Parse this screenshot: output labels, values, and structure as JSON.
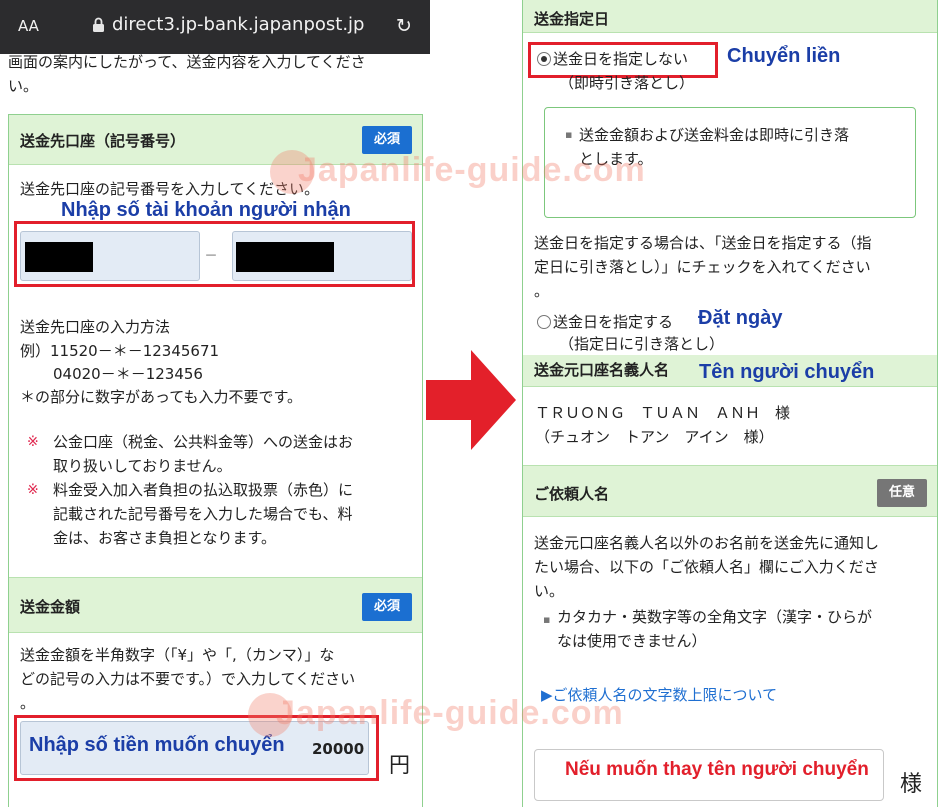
{
  "browser": {
    "text_size_label": "AA",
    "url": "direct3.jp-bank.japanpost.jp",
    "reload_glyph": "↻"
  },
  "left": {
    "intro_line1": "画面の案内にしたがって、送金内容を入力してくださ",
    "intro_line2": "い。",
    "account_section": {
      "title": "送金先口座（記号番号）",
      "required_badge": "必須",
      "instruction": "送金先口座の記号番号を入力してください。",
      "annotation": "Nhập số tài  khoản người nhận",
      "separator": "–",
      "method_title": "送金先口座の入力方法",
      "example_line1": "例）11520－＊－12345671",
      "example_line2": "04020－＊－123456",
      "example_line3": "＊の部分に数字があっても入力不要です。",
      "note1_line1": "公金口座（税金、公共料金等）への送金はお",
      "note1_line2": "取り扱いしておりません。",
      "note2_line1": "料金受入加入者負担の払込取扱票（赤色）に",
      "note2_line2": "記載された記号番号を入力した場合でも、料",
      "note2_line3": "金は、お客さま負担となります。",
      "note_mark": "※"
    },
    "amount_section": {
      "title": "送金金額",
      "required_badge": "必須",
      "instruction_line1": "送金金額を半角数字（「¥」や「,（カンマ）」な",
      "instruction_line2": "どの記号の入力は不要です。）で入力してください",
      "instruction_line3": "。",
      "annotation": "Nhập số tiền muốn chuyển",
      "amount_value": "20000",
      "currency": "円"
    }
  },
  "right": {
    "date_section": {
      "title": "送金指定日",
      "option_immediate": "送金日を指定しない",
      "option_immediate_sub": "（即時引き落とし）",
      "annotation_immediate": "Chuyển liền",
      "info_line1": "送金金額および送金料金は即時に引き落",
      "info_line2": "とします。",
      "info_bullet": "▪",
      "explain_line1": "送金日を指定する場合は、「送金日を指定する（指",
      "explain_line2": "定日に引き落とし）」にチェックを入れてください",
      "explain_line3": "。",
      "option_date": "送金日を指定する",
      "option_date_sub": "（指定日に引き落とし）",
      "annotation_date": "Đặt ngày"
    },
    "sender_section": {
      "title": "送金元口座名義人名",
      "annotation": "Tên người chuyển",
      "name_line1": "ＴＲＵＯＮＧ　ＴＵＡＮ　ＡＮＨ　様",
      "name_line2": "（チュオン　トアン　アイン　様）"
    },
    "requester_section": {
      "title": "ご依頼人名",
      "optional_badge": "任意",
      "desc_line1": "送金元口座名義人名以外のお名前を送金先に通知し",
      "desc_line2": "たい場合、以下の「ご依頼人名」欄にご入力くださ",
      "desc_line3": "い。",
      "bullet_line1": "カタカナ・英数字等の全角文字（漢字・ひらが",
      "bullet_line2": "なは使用できません）",
      "bullet": "▪",
      "link": "▶ご依頼人名の文字数上限について",
      "annotation": "Nếu muốn thay tên người chuyển",
      "suffix": "様"
    }
  },
  "watermark": {
    "text": "Japanlife-guide.com"
  }
}
